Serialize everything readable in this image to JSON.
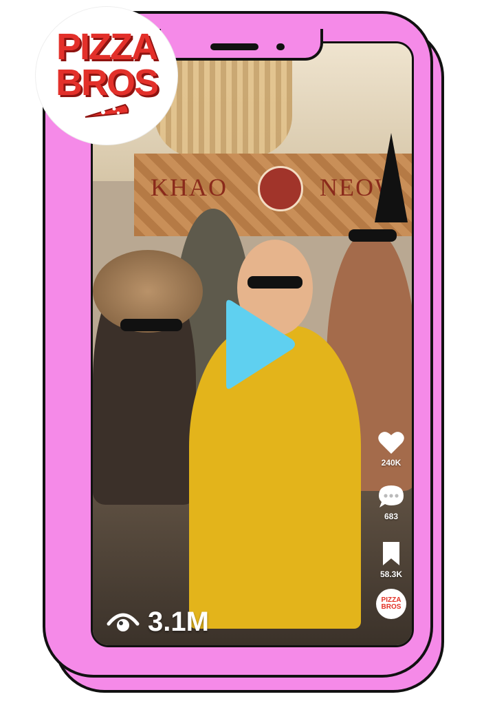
{
  "brand": {
    "line1": "PIZZA",
    "line2": "BROS",
    "color": "#e3302a"
  },
  "video": {
    "store_sign_left": "KHAO",
    "store_sign_right": "NEOW",
    "play_color": "#5fd0f0"
  },
  "rail": {
    "likes": "240K",
    "comments": "683",
    "saves": "58.3K",
    "avatar_line1": "PIZZA",
    "avatar_line2": "BROS"
  },
  "views": {
    "count": "3.1M",
    "icon": "eye-icon"
  },
  "colors": {
    "phone": "#f58ae8",
    "outline": "#111111"
  }
}
